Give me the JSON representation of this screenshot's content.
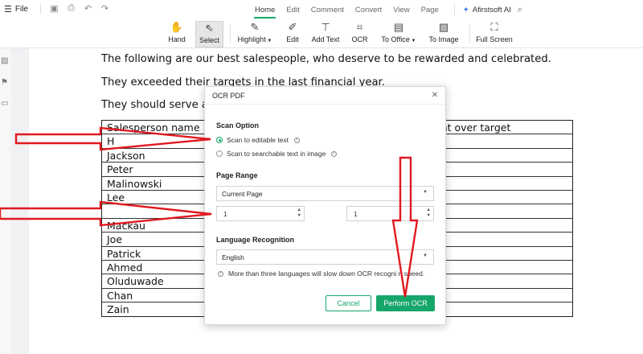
{
  "menu": {
    "file_label": "File"
  },
  "tabs": [
    "Home",
    "Edit",
    "Comment",
    "Convert",
    "View",
    "Page"
  ],
  "active_tab": "Home",
  "ai_label": "Afirstsoft AI",
  "toolbar": {
    "hand": "Hand",
    "select": "Select",
    "highlight": "Highlight",
    "edit": "Edit",
    "add_text": "Add Text",
    "ocr": "OCR",
    "to_office": "To Office",
    "to_image": "To Image",
    "full_screen": "Full Screen"
  },
  "document": {
    "paragraphs": [
      "The following are our best salespeople, who deserve to be rewarded and celebrated.",
      "They exceeded their targets in the last financial year.",
      "They should serve as ro"
    ],
    "table_header": [
      "Salesperson name",
      "ent over target"
    ],
    "rows": [
      "H",
      "Jackson",
      "Peter",
      "Malinowski",
      "Lee",
      "",
      "Mackau",
      "Joe",
      "Patrick",
      "Ahmed",
      "Oluduwade",
      "Chan",
      "Zain"
    ]
  },
  "dialog": {
    "title": "OCR PDF",
    "scan_option_title": "Scan Option",
    "scan_options": [
      "Scan to editable text",
      "Scan to searchable text in image"
    ],
    "selected_scan_option": 0,
    "page_range_title": "Page Range",
    "page_range_value": "Current Page",
    "page_from": "1",
    "page_to": "1",
    "language_title": "Language Recognition",
    "language_value": "English",
    "note": "More than three languages will slow down OCR recogni   n speed.",
    "cancel_label": "Cancel",
    "perform_label": "Perform OCR"
  },
  "colors": {
    "accent": "#16a66a",
    "arrow": "#e0191f"
  }
}
